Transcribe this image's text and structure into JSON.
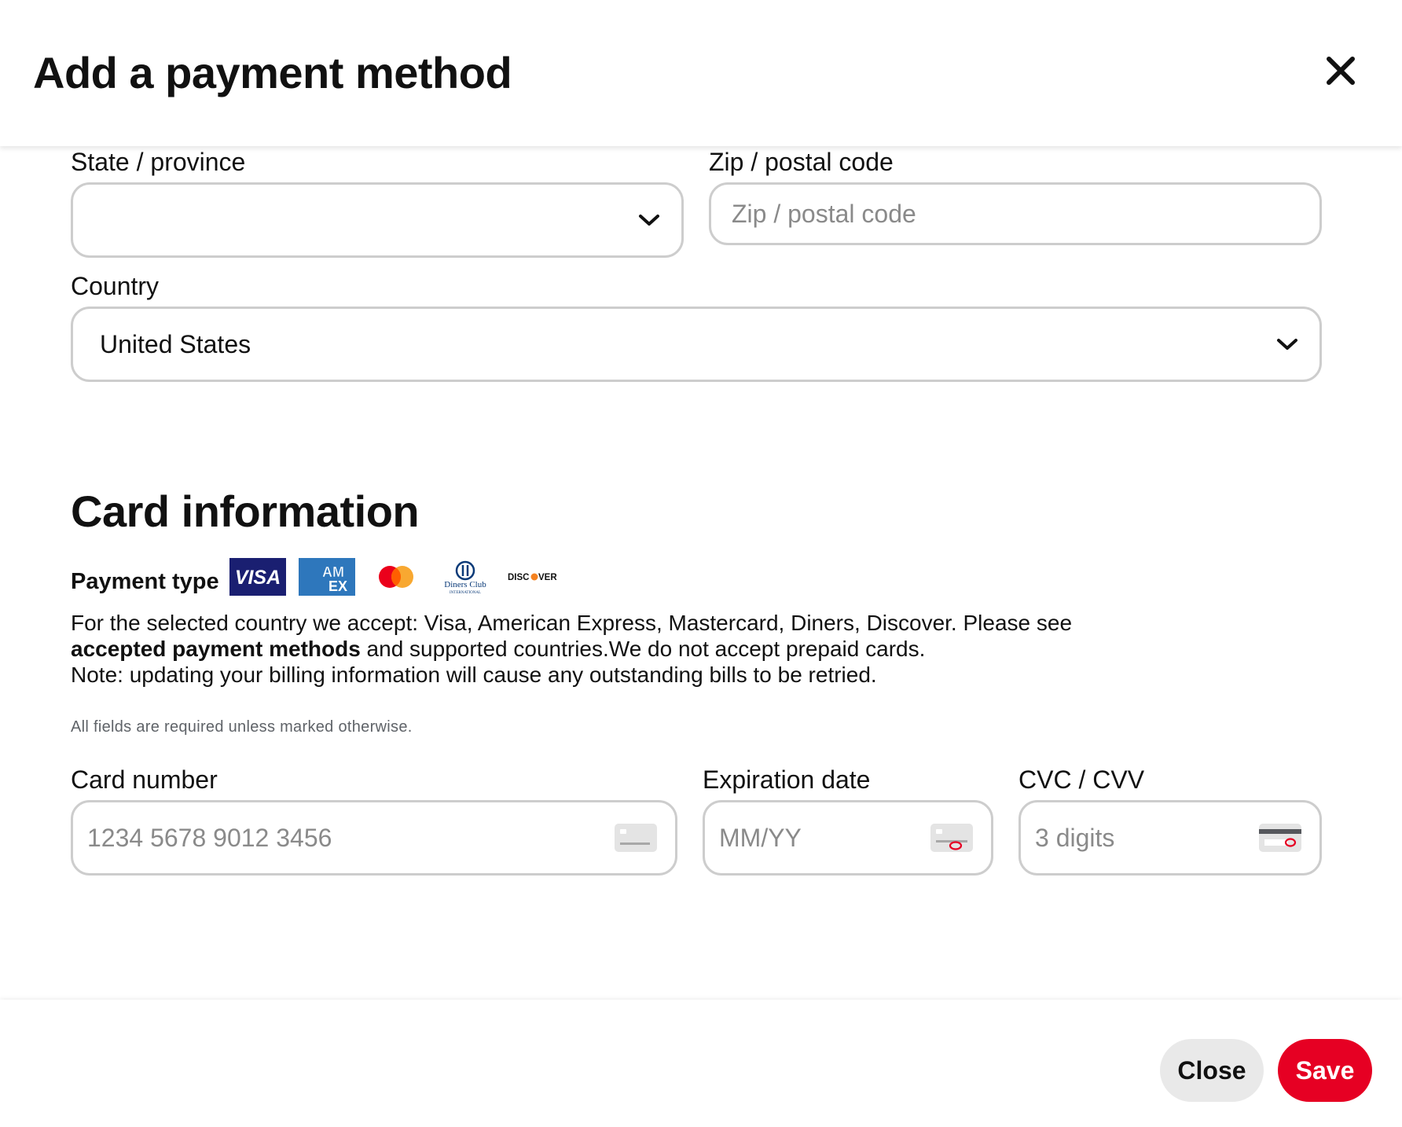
{
  "modal": {
    "title": "Add a payment method"
  },
  "address": {
    "state_label": "State / province",
    "state_value": "",
    "zip_label": "Zip / postal code",
    "zip_placeholder": "Zip / postal code",
    "country_label": "Country",
    "country_value": "United States"
  },
  "card_info": {
    "title": "Card information",
    "payment_type_label": "Payment type",
    "logos": {
      "visa": "VISA",
      "amex": "AM EX",
      "diners": "Diners Club International",
      "discover": "DISCOVER"
    },
    "accepted_text_1": "For the selected country we accept: Visa, American Express, Mastercard, Diners, Discover. Please see",
    "accepted_link": "accepted payment methods",
    "accepted_text_2": " and supported countries.We do not accept prepaid cards.",
    "note_text": "Note: updating your billing information will cause any outstanding bills to be retried.",
    "required_note": "All fields are required unless marked otherwise.",
    "card_number_label": "Card number",
    "card_number_placeholder": "1234 5678 9012 3456",
    "expiration_label": "Expiration date",
    "expiration_placeholder": "MM/YY",
    "cvc_label": "CVC / CVV",
    "cvc_placeholder": "3 digits"
  },
  "footer": {
    "close_label": "Close",
    "save_label": "Save"
  },
  "colors": {
    "brand_red": "#e60023",
    "visa_blue": "#1a1f71",
    "amex_blue": "#2e77bc",
    "border_gray": "#cdcdcd"
  }
}
